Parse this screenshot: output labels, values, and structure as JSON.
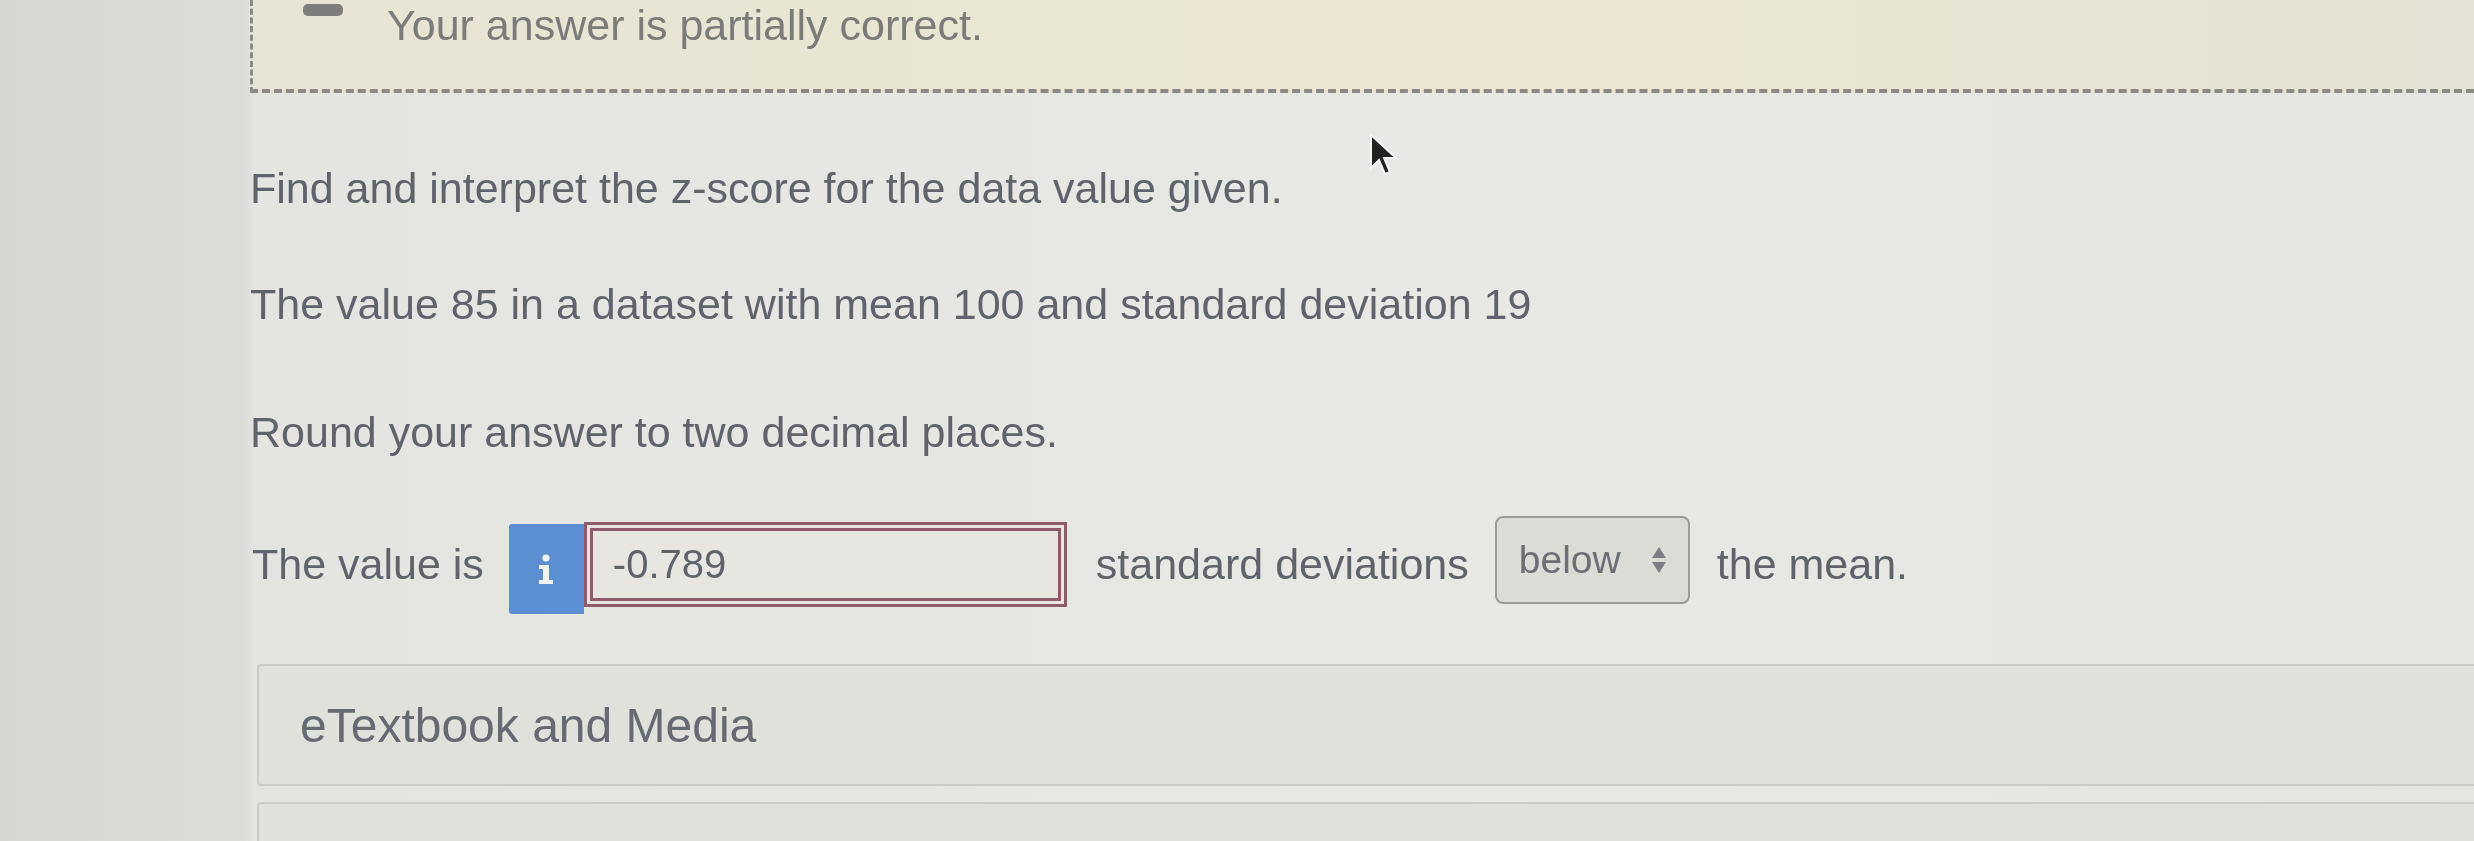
{
  "feedback": {
    "partial": true,
    "message": "Your answer is partially correct."
  },
  "question": {
    "prompt": "Find and interpret the z-score for the data value given.",
    "data": "The value 85 in a dataset with mean 100 and standard deviation 19",
    "instruction": "Round your answer to two decimal places."
  },
  "answer_row": {
    "lead": "The value is",
    "input": {
      "value": "-0.789",
      "incorrect": true
    },
    "middle": "standard deviations",
    "select": {
      "value": "below"
    },
    "tail": "the mean."
  },
  "resources": [
    {
      "label": "eTextbook and Media"
    }
  ]
}
